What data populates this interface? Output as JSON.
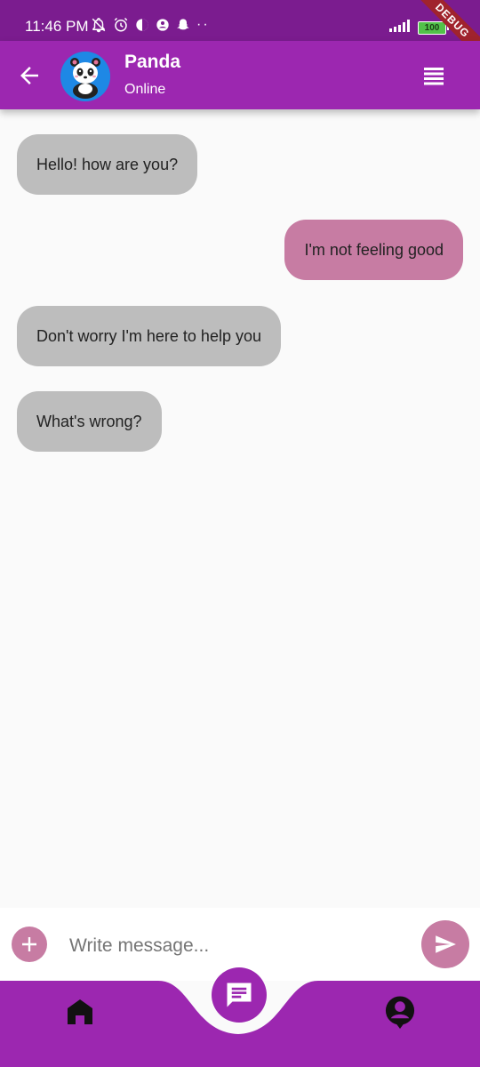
{
  "status_bar": {
    "time": "11:46 PM",
    "battery": "100",
    "debug": "DEBUG"
  },
  "app_bar": {
    "contact_name": "Panda",
    "contact_status": "Online"
  },
  "messages": [
    {
      "text": "Hello! how are you?",
      "sender": "bot"
    },
    {
      "text": "I'm not feeling good",
      "sender": "user"
    },
    {
      "text": "Don't worry I'm here to help you",
      "sender": "bot"
    },
    {
      "text": "What's wrong?",
      "sender": "bot"
    }
  ],
  "composer": {
    "placeholder": "Write message..."
  },
  "colors": {
    "status_bar": "#7b1c8f",
    "primary": "#9c27b0",
    "incoming_bubble": "#bdbdbd",
    "outgoing_bubble": "#c77ca3",
    "accent": "#c77ca3"
  },
  "icons": {
    "back": "arrow-left-icon",
    "menu": "menu-lines-icon",
    "add": "plus-icon",
    "send": "send-icon",
    "home": "home-icon",
    "chat": "chat-icon",
    "profile": "profile-icon"
  }
}
